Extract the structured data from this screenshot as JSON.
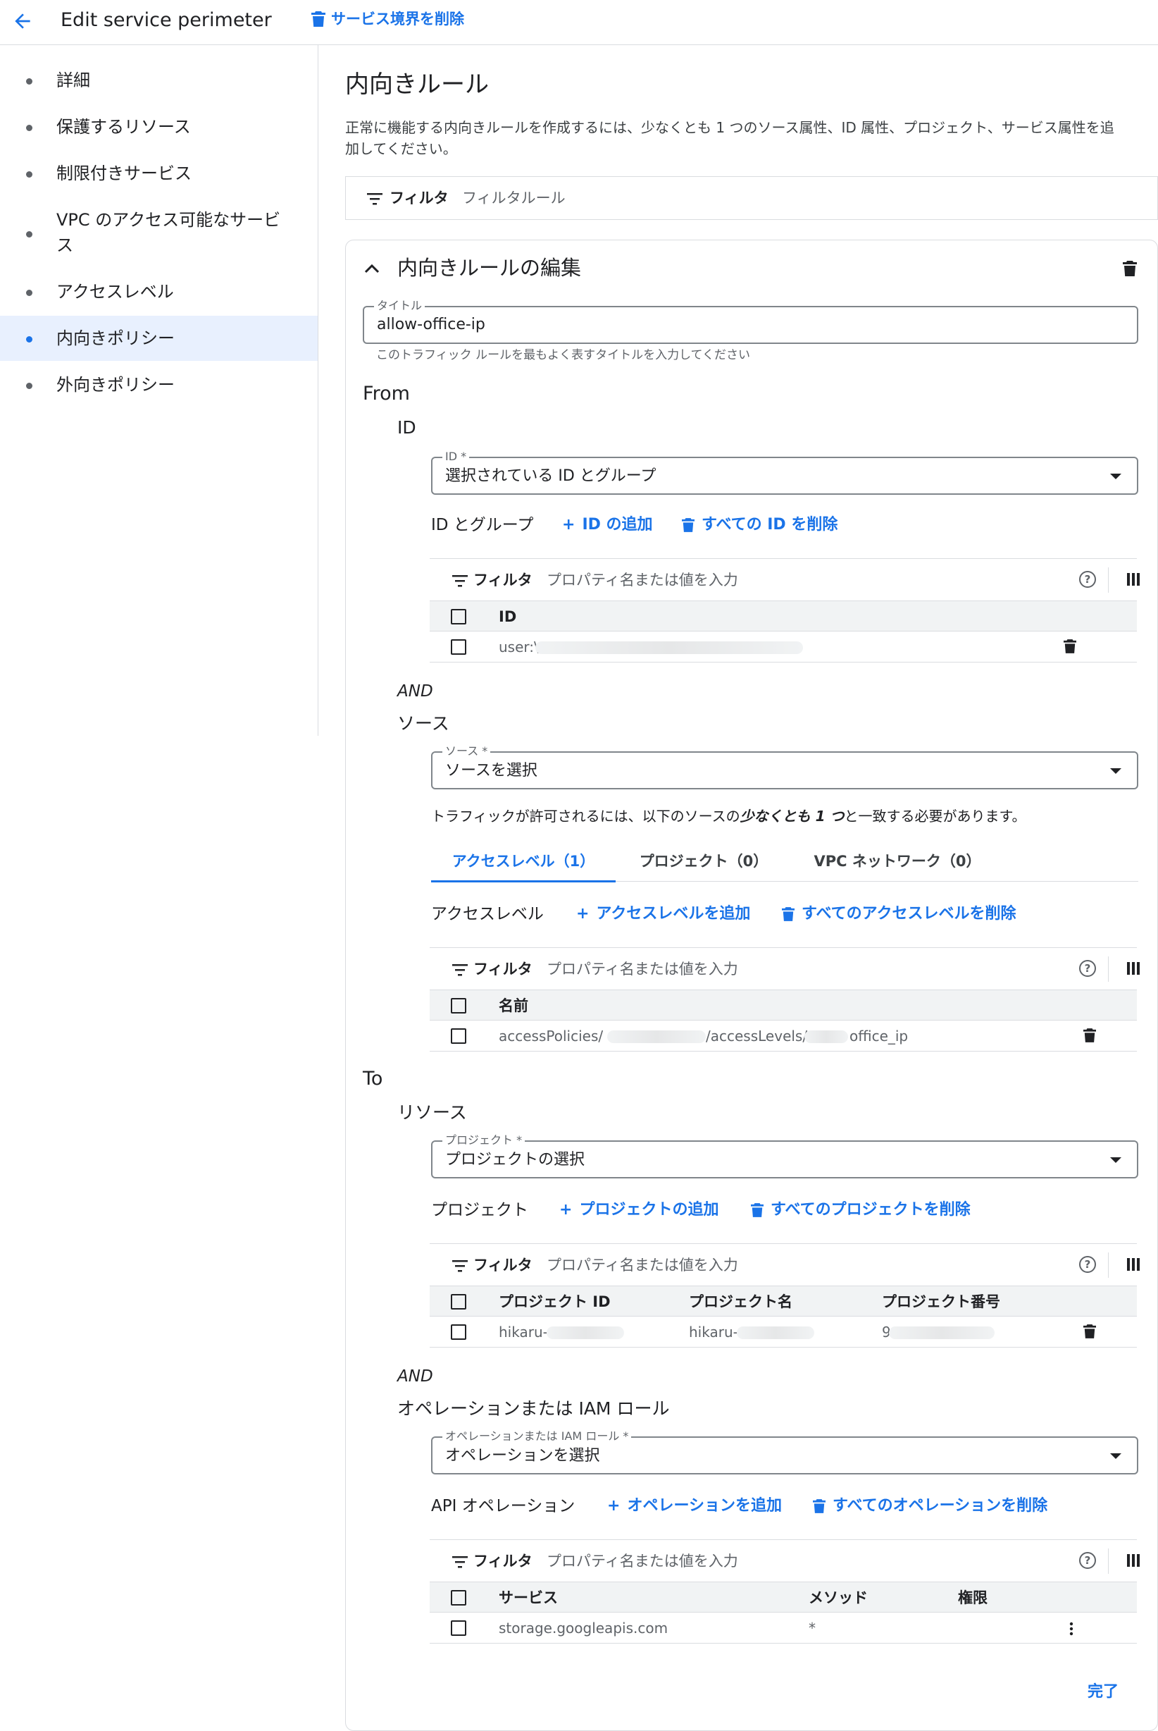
{
  "header": {
    "title": "Edit service perimeter",
    "delete_label": "サービス境界を削除"
  },
  "sidebar": {
    "items": [
      {
        "label": "詳細"
      },
      {
        "label": "保護するリソース"
      },
      {
        "label": "制限付きサービス"
      },
      {
        "label": "VPC のアクセス可能なサービス",
        "label_line2": "ス",
        "label_line1": "VPC のアクセス可能なサービ"
      },
      {
        "label": "アクセスレベル"
      },
      {
        "label": "内向きポリシー",
        "active": true
      },
      {
        "label": "外向きポリシー"
      }
    ]
  },
  "main": {
    "title": "内向きルール",
    "description_line1": "正常に機能する内向きルールを作成するには、少なくとも 1 つのソース属性、ID 属性、プロジェクト、サービス属性を追",
    "description_line2": "加してください。",
    "filter_label": "フィルタ",
    "filter_placeholder": "フィルタルール"
  },
  "rule": {
    "heading": "内向きルールの編集",
    "title_field": {
      "label": "タイトル",
      "value": "allow-office-ip",
      "hint": "このトラフィック ルールを最もよく表すタイトルを入力してください"
    },
    "from_label": "From",
    "id_section": {
      "heading": "ID",
      "select_label": "ID *",
      "select_value": "選択されている ID とグループ",
      "list_label": "ID とグループ",
      "add_label": "ID の追加",
      "remove_label": "すべての ID を削除",
      "filter_label": "フィルタ",
      "filter_placeholder": "プロパティ名または値を入力",
      "column": "ID",
      "rows": [
        {
          "value": "user:\\"
        }
      ]
    },
    "and_label_1": "AND",
    "source_section": {
      "heading": "ソース",
      "select_label": "ソース *",
      "select_value": "ソースを選択",
      "note_a": "トラフィックが許可されるには、以下のソースの",
      "note_b": "少なくとも 1 つ",
      "note_c": "と一致する必要があります。",
      "tabs": [
        "アクセスレベル（1）",
        "プロジェクト（0）",
        "VPC ネットワーク（0）"
      ],
      "list_label": "アクセスレベル",
      "add_label": "アクセスレベルを追加",
      "remove_label": "すべてのアクセスレベルを削除",
      "filter_label": "フィルタ",
      "filter_placeholder": "プロパティ名または値を入力",
      "column": "名前",
      "row_a": "accessPolicies/",
      "row_b": "/accessLevels/",
      "row_c": "office_ip"
    },
    "to_label": "To",
    "resource_section": {
      "heading": "リソース",
      "select_label": "プロジェクト *",
      "select_value": "プロジェクトの選択",
      "list_label": "プロジェクト",
      "add_label": "プロジェクトの追加",
      "remove_label": "すべてのプロジェクトを削除",
      "filter_label": "フィルタ",
      "filter_placeholder": "プロパティ名または値を入力",
      "columns": [
        "プロジェクト ID",
        "プロジェクト名",
        "プロジェクト番号"
      ],
      "row": [
        "hikaru-",
        "hikaru-",
        "9"
      ]
    },
    "and_label_2": "AND",
    "operation_section": {
      "heading": "オペレーションまたは IAM ロール",
      "select_label": "オペレーションまたは IAM ロール *",
      "select_value": "オペレーションを選択",
      "list_label": "API オペレーション",
      "add_label": "オペレーションを追加",
      "remove_label": "すべてのオペレーションを削除",
      "filter_label": "フィルタ",
      "filter_placeholder": "プロパティ名または値を入力",
      "columns": [
        "サービス",
        "メソッド",
        "権限"
      ],
      "row": [
        "storage.googleapis.com",
        "*",
        ""
      ]
    },
    "done_label": "完了"
  },
  "colors": {
    "accent": "#1a73e8",
    "text": "#202124",
    "muted": "#5f6368",
    "border": "#dadce0"
  },
  "icons": [
    "back-arrow-icon",
    "trash-icon",
    "filter-icon",
    "chevron-up-icon",
    "plus-icon",
    "help-icon",
    "columns-icon",
    "dropdown-arrow-icon",
    "more-vert-icon"
  ]
}
